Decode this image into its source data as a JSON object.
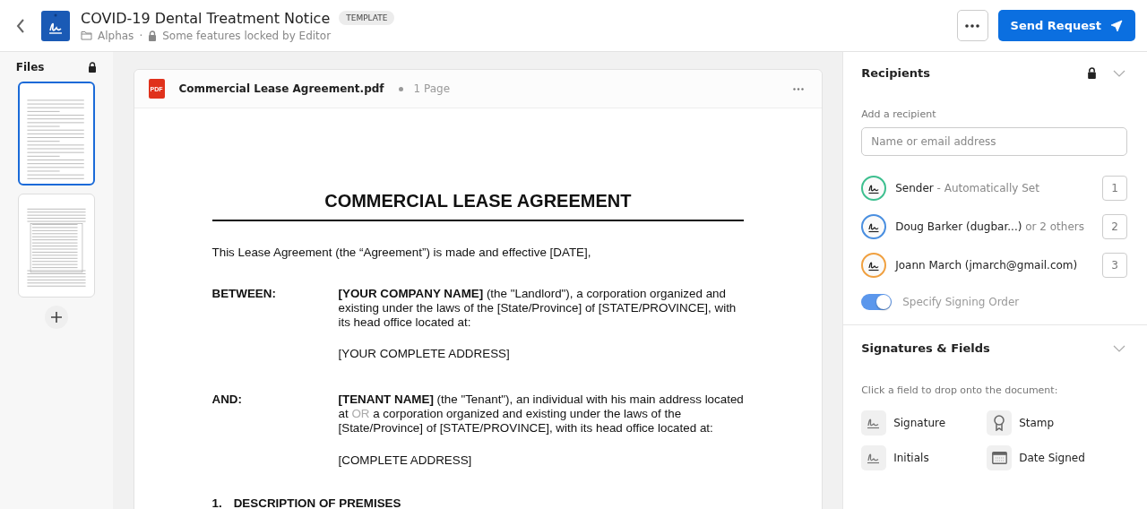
{
  "header": {
    "title": "COVID-19 Dental Treatment Notice",
    "badge": "TEMPLATE",
    "folder": "Alphas",
    "separator": "·",
    "lock_note": "Some features locked by Editor",
    "send_button": "Send Request"
  },
  "files": {
    "title": "Files",
    "pages": [
      {
        "selected": true,
        "kind": "letter"
      },
      {
        "selected": false,
        "kind": "form"
      }
    ]
  },
  "document": {
    "file_icon": "PDF",
    "name": "Commercial Lease Agreement.pdf",
    "pages": "1 Page",
    "title": "COMMERCIAL LEASE AGREEMENT",
    "intro": "This Lease Agreement (the “Agreement”) is made and effective [DATE],",
    "parties": [
      {
        "label": "BETWEEN:",
        "paragraphs": [
          [
            {
              "text": "[YOUR COMPANY NAME]",
              "kind": "bold"
            },
            {
              "text": " (the \"Landlord\"), a corporation organized and existing under the laws of the [State/Province] of [STATE/PROVINCE], with its head office located at:",
              "kind": "plain"
            }
          ],
          [
            {
              "text": "[YOUR COMPLETE ADDRESS]",
              "kind": "plain"
            }
          ]
        ]
      },
      {
        "label": "AND:",
        "paragraphs": [
          [
            {
              "text": "[TENANT NAME]",
              "kind": "bold"
            },
            {
              "text": " (the \"Tenant\"), an individual with his main address located at ",
              "kind": "plain"
            },
            {
              "text": "OR",
              "kind": "muted"
            },
            {
              "text": " a corporation organized and existing under the laws of the [State/Province] of [STATE/PROVINCE], with its head office located at:",
              "kind": "plain"
            }
          ],
          [
            {
              "text": "[COMPLETE ADDRESS]",
              "kind": "plain"
            }
          ]
        ]
      }
    ],
    "section": {
      "number": "1.",
      "title": "DESCRIPTION OF PREMISES"
    }
  },
  "recipients": {
    "title": "Recipients",
    "add_label": "Add a recipient",
    "placeholder": "Name or email address",
    "list": [
      {
        "name": "Sender",
        "detail": " - Automatically Set",
        "order": "1",
        "color": "#3dbf8f"
      },
      {
        "name": "Doug Barker (dugbar...)",
        "detail": " or 2 others",
        "order": "2",
        "color": "#4a8fe0"
      },
      {
        "name": "Joann March (jmarch@gmail.com)",
        "order": "3",
        "color": "#f0a040"
      }
    ],
    "signing_order": {
      "label": "Specify Signing Order",
      "on": true
    }
  },
  "fields": {
    "title": "Signatures & Fields",
    "hint": "Click a field to drop onto the document:",
    "items": [
      {
        "label": "Signature",
        "kind": "signature"
      },
      {
        "label": "Stamp",
        "kind": "stamp"
      },
      {
        "label": "Initials",
        "kind": "initials"
      },
      {
        "label": "Date Signed",
        "kind": "date"
      }
    ]
  }
}
